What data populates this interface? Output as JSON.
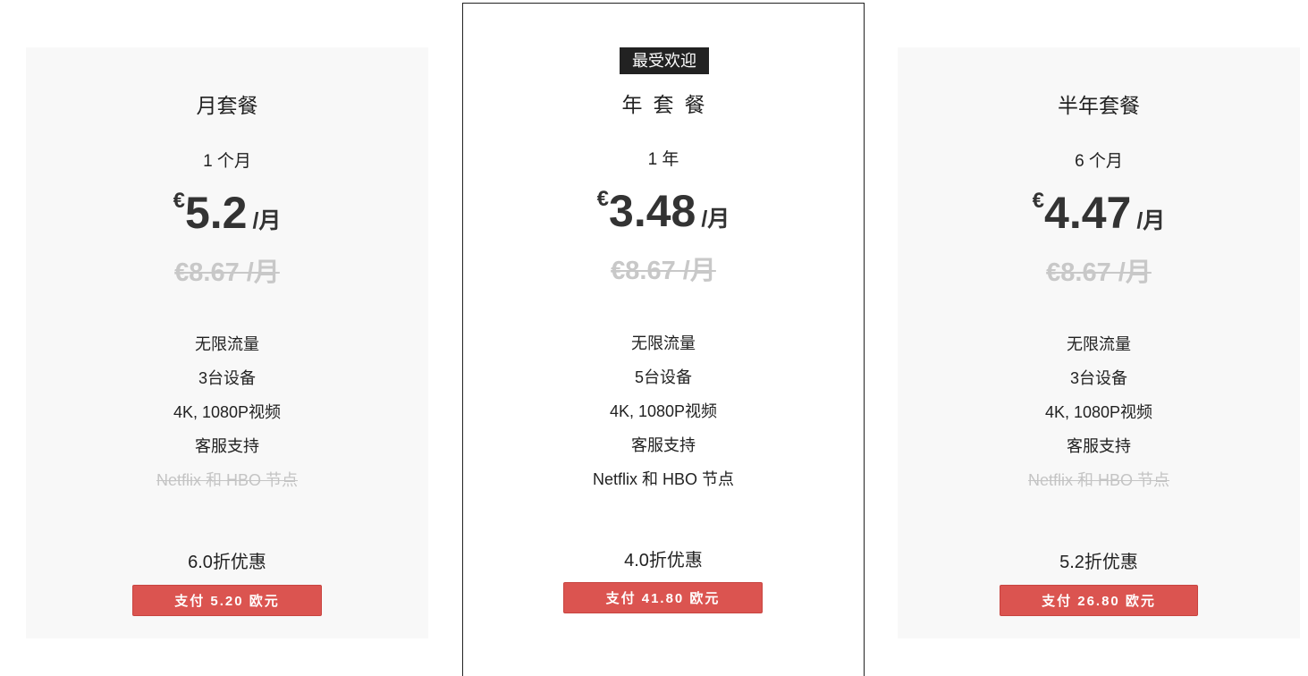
{
  "colors": {
    "card_bg": "#f8f8f8",
    "featured_border": "#222222",
    "badge_bg": "#222222",
    "pay_button": "#db5450",
    "strikethrough_text": "#c4c4c4"
  },
  "plans": [
    {
      "name": "月套餐",
      "duration": "1 个月",
      "currency": "€",
      "price": "5.2",
      "per": "/月",
      "old_price": "€8.67 /月",
      "features": [
        {
          "label": "无限流量",
          "included": true
        },
        {
          "label": "3台设备",
          "included": true
        },
        {
          "label": "4K, 1080P视频",
          "included": true
        },
        {
          "label": "客服支持",
          "included": true
        },
        {
          "label": "Netflix 和 HBO 节点",
          "included": false
        }
      ],
      "discount": "6.0折优惠",
      "pay_label": "支付 5.20 欧元"
    },
    {
      "badge": "最受欢迎",
      "name": "年套餐",
      "duration": "1 年",
      "currency": "€",
      "price": "3.48",
      "per": "/月",
      "old_price": "€8.67 /月",
      "features": [
        {
          "label": "无限流量",
          "included": true
        },
        {
          "label": "5台设备",
          "included": true
        },
        {
          "label": "4K, 1080P视频",
          "included": true
        },
        {
          "label": "客服支持",
          "included": true
        },
        {
          "label": "Netflix 和 HBO 节点",
          "included": true
        }
      ],
      "discount": "4.0折优惠",
      "pay_label": "支付 41.80 欧元"
    },
    {
      "name": "半年套餐",
      "duration": "6 个月",
      "currency": "€",
      "price": "4.47",
      "per": "/月",
      "old_price": "€8.67 /月",
      "features": [
        {
          "label": "无限流量",
          "included": true
        },
        {
          "label": "3台设备",
          "included": true
        },
        {
          "label": "4K, 1080P视频",
          "included": true
        },
        {
          "label": "客服支持",
          "included": true
        },
        {
          "label": "Netflix 和 HBO 节点",
          "included": false
        }
      ],
      "discount": "5.2折优惠",
      "pay_label": "支付 26.80 欧元"
    }
  ]
}
